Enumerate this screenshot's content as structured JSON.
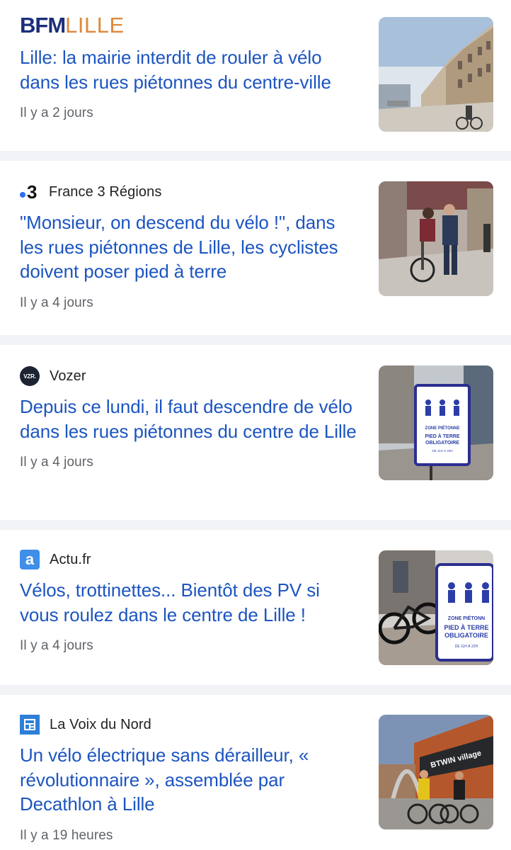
{
  "articles": [
    {
      "source": "BFM LILLE",
      "logo_bfm": "BFM",
      "logo_city": "LILLE",
      "title": "Lille: la mairie interdit de rouler à vélo dans les rues piétonnes du centre-ville",
      "time": "Il y a 2 jours",
      "thumbnail": "street-with-buildings-photo"
    },
    {
      "source": "France 3 Régions",
      "logo_text": "3",
      "title": "\"Monsieur, on descend du vélo !\", dans les rues piétonnes de Lille, les cyclistes doivent poser pied à terre",
      "time": "Il y a 4 jours",
      "thumbnail": "police-and-cyclist-photo"
    },
    {
      "source": "Vozer",
      "logo_text": "VZR.",
      "title": "Depuis ce lundi, il faut descendre de vélo dans les rues piétonnes du centre de Lille",
      "time": "Il y a 4 jours",
      "thumbnail": "pedestrian-zone-sign-photo"
    },
    {
      "source": "Actu.fr",
      "logo_text": "a",
      "title": "Vélos, trottinettes... Bientôt des PV si vous roulez dans le centre de Lille !",
      "time": "Il y a 4 jours",
      "thumbnail": "bicycle-and-sign-photo"
    },
    {
      "source": "La Voix du Nord",
      "title": "Un vélo électrique sans dérailleur, « révolutionnaire », assemblée par Decathlon à Lille",
      "time": "Il y a 19 heures",
      "thumbnail": "cyclists-at-btwin-village-photo"
    }
  ],
  "sign_text": {
    "line1": "ZONE PIÉTONNE",
    "line2": "PIED À TERRE",
    "line3": "OBLIGATOIRE",
    "line4": "DE 11H À 22H"
  },
  "sign_text_cropped": {
    "line1": "ZONE PIÉTONN",
    "line2": "PIED À TERRE",
    "line3": "OBLIGATOIRE",
    "line4": "DE 11H À 22H"
  },
  "storefront_text": "BTWIN village",
  "colors": {
    "headline": "#1c55c0",
    "time": "#5f6368",
    "separator": "#f1f3f6",
    "bfm_blue": "#1a2f7a",
    "bfm_orange": "#e0883b"
  }
}
